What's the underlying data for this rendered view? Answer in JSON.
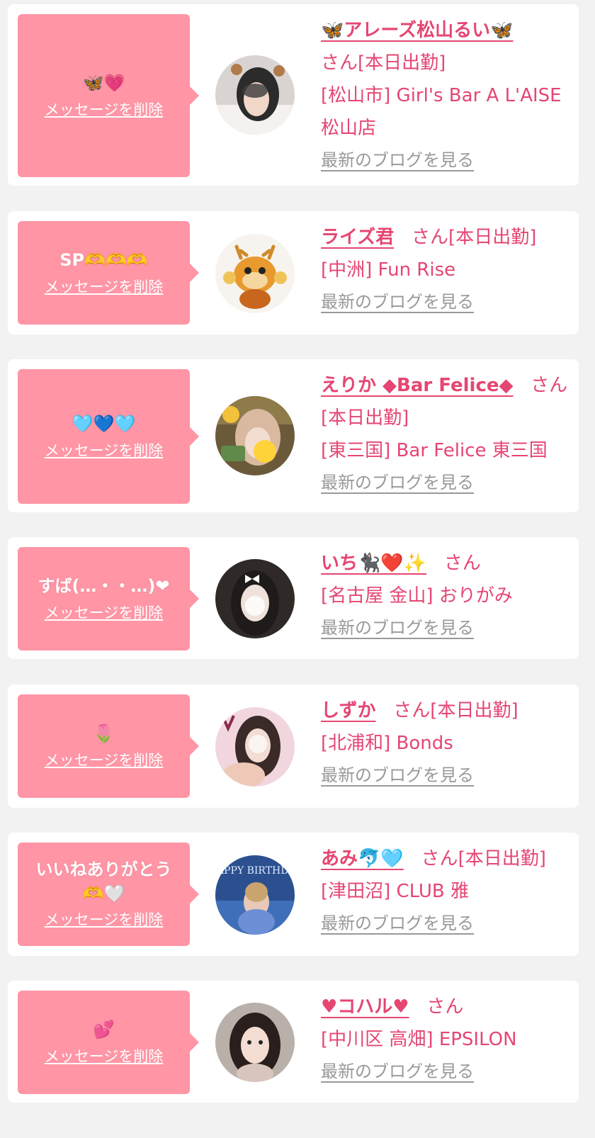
{
  "common": {
    "delete_label": "メッセージを削除",
    "blog_label": "最新のブログを見る",
    "san_label": "さん"
  },
  "colors": {
    "background": "#f2f2f2",
    "card": "#ffffff",
    "bubble": "#ff95a5",
    "accent": "#e54672",
    "link_gray": "#999999"
  },
  "cards": [
    {
      "message": "🦋💗",
      "name": "🦋アレーズ松山るい🦋",
      "status": "[本日出勤]",
      "shop": "[松山市] Girl's Bar A L'AISE 松山店",
      "avatar_icon": "avatar-photo-icon"
    },
    {
      "message": "SP🫶🫶🫶",
      "name": "ライズ君",
      "status": "[本日出勤]",
      "shop": "[中洲] Fun Rise",
      "avatar_icon": "deer-mascot-icon"
    },
    {
      "message": "🩵💙🩵",
      "name": "えりか ◆Bar Felice◆",
      "status": "[本日出勤]",
      "shop": "[東三国] Bar Felice 東三国",
      "avatar_icon": "avatar-photo-icon"
    },
    {
      "message": "すば(…・・…)❤︎",
      "name": "いち🐈‍⬛❤️✨",
      "status": "",
      "shop": "[名古屋 金山] おりがみ",
      "avatar_icon": "avatar-photo-icon"
    },
    {
      "message": "🌷",
      "name": "しずか",
      "status": "[本日出勤]",
      "shop": "[北浦和] Bonds",
      "avatar_icon": "avatar-photo-icon"
    },
    {
      "message": "いいねありがとう🫶🤍",
      "name": "あみ🐬🩵",
      "status": "[本日出勤]",
      "shop": "[津田沼] CLUB 雅",
      "avatar_icon": "birthday-photo-icon",
      "avatar_text": "HAPPY BIRTHDAY"
    },
    {
      "message": "💕",
      "name": "♥コハル♥",
      "status": "",
      "shop": "[中川区 高畑] EPSILON",
      "avatar_icon": "avatar-photo-icon"
    }
  ]
}
